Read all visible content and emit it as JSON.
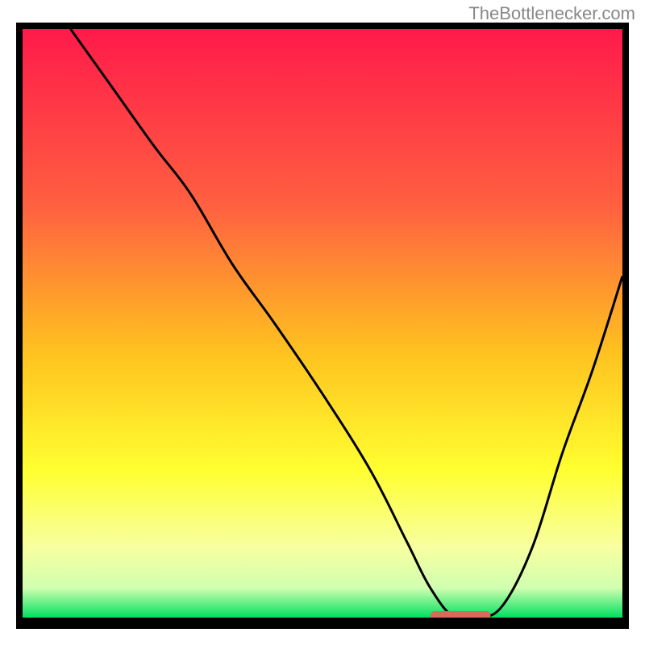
{
  "watermark": "TheBottlenecker.com",
  "chart_data": {
    "type": "line",
    "title": "",
    "xlabel": "",
    "ylabel": "",
    "xlim": [
      0,
      100
    ],
    "ylim": [
      0,
      100
    ],
    "gradient_stops": [
      {
        "offset": 0,
        "color": "#ff1a4a"
      },
      {
        "offset": 30,
        "color": "#ff6040"
      },
      {
        "offset": 55,
        "color": "#ffc220"
      },
      {
        "offset": 75,
        "color": "#ffff30"
      },
      {
        "offset": 88,
        "color": "#f8ffa0"
      },
      {
        "offset": 95,
        "color": "#d0ffb0"
      },
      {
        "offset": 100,
        "color": "#00e060"
      }
    ],
    "series": [
      {
        "name": "bottleneck-curve",
        "color": "#000000",
        "x": [
          8,
          15,
          22,
          28,
          35,
          42,
          50,
          58,
          64,
          68,
          72,
          76,
          80,
          85,
          90,
          95,
          100
        ],
        "y": [
          100,
          90,
          80,
          72,
          60,
          50,
          38,
          25,
          13,
          5,
          0,
          0,
          2,
          12,
          28,
          42,
          58
        ]
      }
    ],
    "marker": {
      "name": "optimal-range",
      "x_start": 68,
      "x_end": 78,
      "y": 0,
      "color": "#d86a5a"
    }
  }
}
